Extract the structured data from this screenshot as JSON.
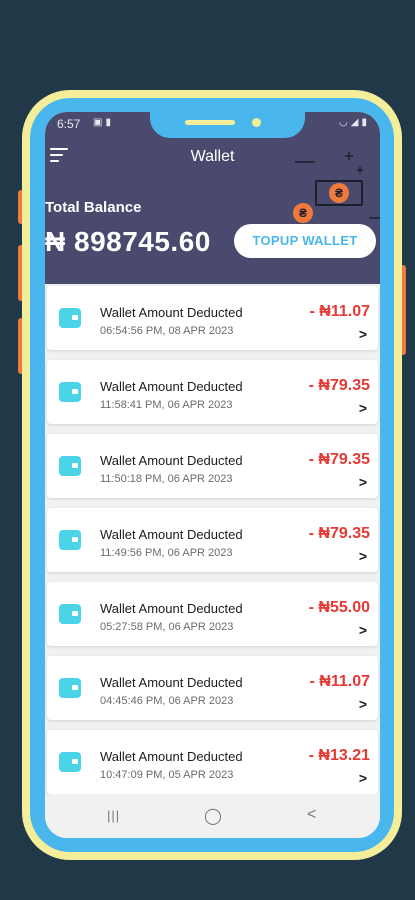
{
  "status_bar": {
    "time": "6:57",
    "left_icons": [
      "image-icon",
      "lock-icon"
    ],
    "right_icons": [
      "wifi-icon",
      "signal-icon",
      "battery-icon"
    ]
  },
  "header": {
    "title": "Wallet",
    "menu_icon": "hamburger-menu-icon"
  },
  "balance": {
    "label": "Total Balance",
    "amount": "₦ 898745.60",
    "topup_label": "TOPUP WALLET"
  },
  "decoration": {
    "coin_symbol": "₴"
  },
  "transactions": [
    {
      "title": "Wallet Amount Deducted",
      "date": "06:54:56 PM, 08 APR 2023",
      "amount": "- ₦11.07"
    },
    {
      "title": "Wallet Amount Deducted",
      "date": "11:58:41 PM, 06 APR 2023",
      "amount": "- ₦79.35"
    },
    {
      "title": "Wallet Amount Deducted",
      "date": "11:50:18 PM, 06 APR 2023",
      "amount": "- ₦79.35"
    },
    {
      "title": "Wallet Amount Deducted",
      "date": "11:49:56 PM, 06 APR 2023",
      "amount": "- ₦79.35"
    },
    {
      "title": "Wallet Amount Deducted",
      "date": "05:27:58 PM, 06 APR 2023",
      "amount": "- ₦55.00"
    },
    {
      "title": "Wallet Amount Deducted",
      "date": "04:45:46 PM, 06 APR 2023",
      "amount": "- ₦11.07"
    },
    {
      "title": "Wallet Amount Deducted",
      "date": "10:47:09 PM, 05 APR 2023",
      "amount": "- ₦13.21"
    }
  ],
  "nav": {
    "recents": "|||",
    "home": "◯",
    "back": "<"
  },
  "colors": {
    "background": "#213848",
    "header": "#4a4a6e",
    "accent": "#4ab6ee",
    "amount": "#e53935",
    "wallet_icon": "#4ad4e8"
  }
}
